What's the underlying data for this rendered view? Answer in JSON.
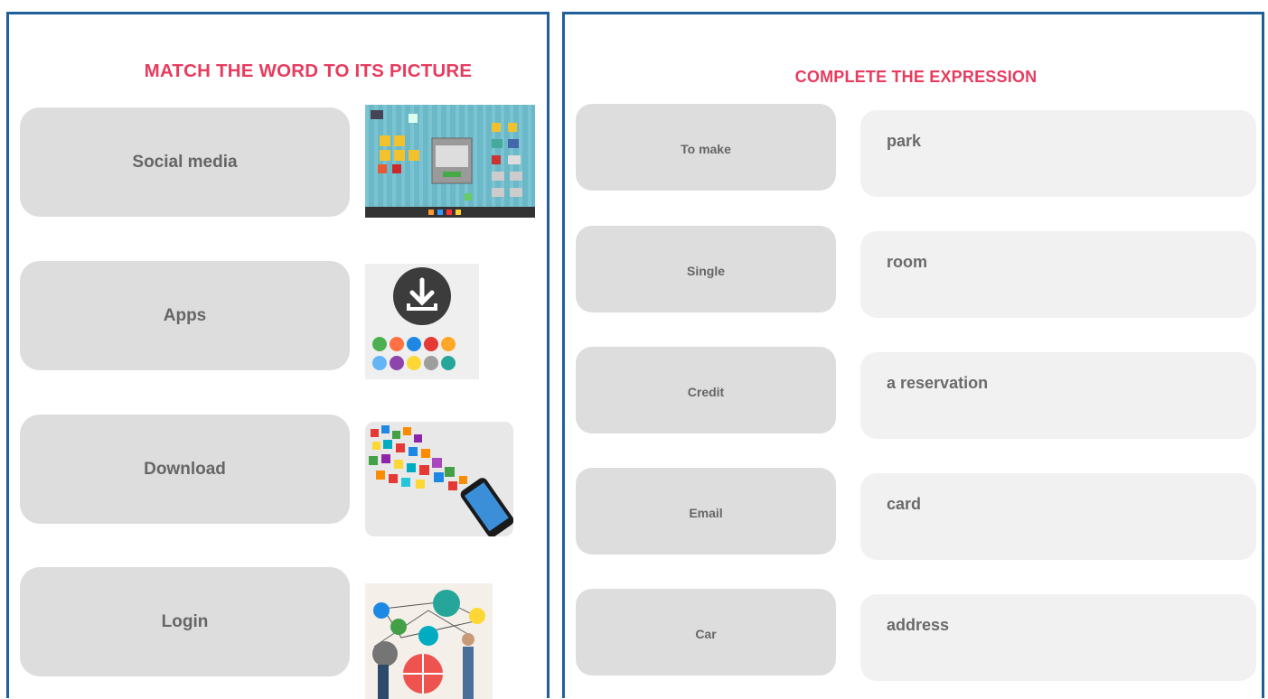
{
  "left_panel": {
    "title": "MATCH THE WORD TO ITS PICTURE",
    "words": [
      "Social media",
      "Apps",
      "Download",
      "Login"
    ],
    "pictures": [
      {
        "icon": "desktop-windows-picture"
      },
      {
        "icon": "download-apps-picture"
      },
      {
        "icon": "phone-apps-burst-picture"
      },
      {
        "icon": "people-network-picture"
      }
    ]
  },
  "right_panel": {
    "title": "COMPLETE THE EXPRESSION",
    "left_items": [
      "To make",
      "Single",
      "Credit",
      "Email",
      "Car"
    ],
    "right_items": [
      "park",
      "room",
      "a reservation",
      "card",
      "address"
    ]
  },
  "colors": {
    "accent": "#e63c5f",
    "border": "#1f5f9a",
    "card": "#dddddd",
    "answer_card": "#f1f1f1",
    "text": "#666666"
  }
}
